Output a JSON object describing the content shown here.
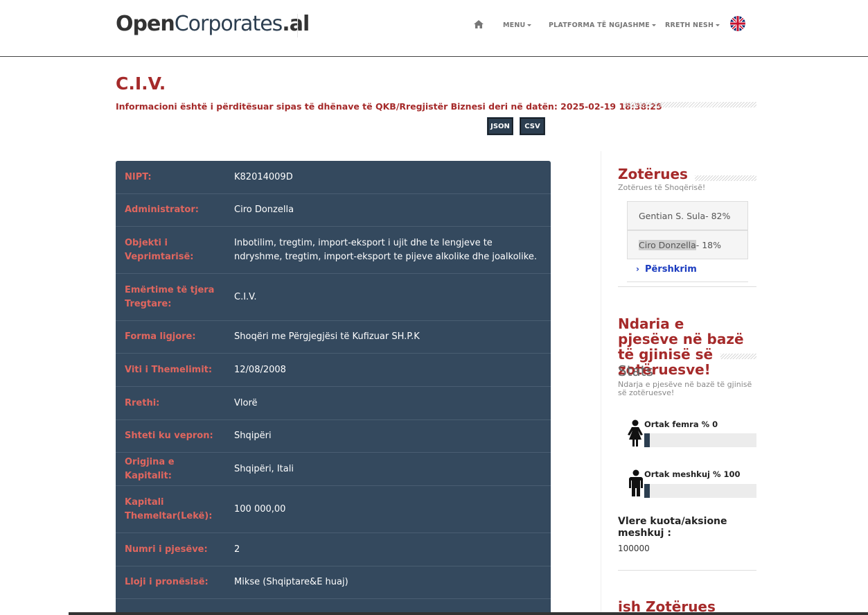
{
  "header": {
    "logo": {
      "open": "Open",
      "corporates": "Corporates",
      "tld": ".al"
    },
    "nav": [
      {
        "label": "MENU"
      },
      {
        "label": "PLATFORMA TË NGJASHME"
      },
      {
        "label": "RRETH NESH"
      }
    ]
  },
  "company": {
    "title": "C.I.V.",
    "update_text": "Informacioni është i përditësuar sipas të dhënave të QKB/Rregjistër Biznesi deri në datën: 2025-02-19 18:38:25",
    "buttons": {
      "json": "JSON",
      "csv": "CSV"
    }
  },
  "info": [
    {
      "label": "NIPT:",
      "value": "K82014009D"
    },
    {
      "label": "Administrator:",
      "value": "Ciro Donzella"
    },
    {
      "label": "Objekti i Veprimtarisë:",
      "value": "Inbotilim, tregtim, import-eksport i ujit dhe te lengjeve te ndryshme, tregtim, import-eksport te pijeve alkolike dhe joalkolike."
    },
    {
      "label": "Emërtime të tjera Tregtare:",
      "value": "C.I.V."
    },
    {
      "label": "Forma ligjore:",
      "value": "Shoqëri me Përgjegjësi të Kufizuar SH.P.K"
    },
    {
      "label": "Viti i Themelimit:",
      "value": "12/08/2008"
    },
    {
      "label": "Rrethi:",
      "value": "Vlorë"
    },
    {
      "label": "Shteti ku vepron:",
      "value": "Shqipëri"
    },
    {
      "label": "Origjina e Kapitalit:",
      "value": "Shqipëri, Itali"
    },
    {
      "label": "Kapitali Themeltar(Lekë):",
      "value": "100 000,00"
    },
    {
      "label": "Numri i pjesëve:",
      "value": "2"
    },
    {
      "label": "Lloji i pronësisë:",
      "value": "Mikse (Shqiptare&E huaj)"
    }
  ],
  "sidebar": {
    "owners_title": "Zotërues",
    "owners_subtitle": "Zotërues të Shoqërisë!",
    "owners": [
      {
        "name": "Gentian S. Sula",
        "share": " - 82%"
      },
      {
        "name": "Ciro Donzella",
        "share": " - 18%"
      }
    ],
    "description_link": "Përshkrim",
    "gender_title": "Ndaria e pjesëve në bazë të gjinisë së zotëruesve!",
    "stats_title": "Stats",
    "stats_subtitle": "Ndarja e pjesëve në bazë të gjinisë së zotëruesve!",
    "female_label": "Ortak femra % 0",
    "female_percent": 0,
    "male_label": "Ortak meshkuj % 100",
    "male_percent": 100,
    "vlere_label": "Vlere kuota/aksione meshkuj :",
    "vlere_value": "100000",
    "former_owners_title": "ish Zotërues"
  }
}
